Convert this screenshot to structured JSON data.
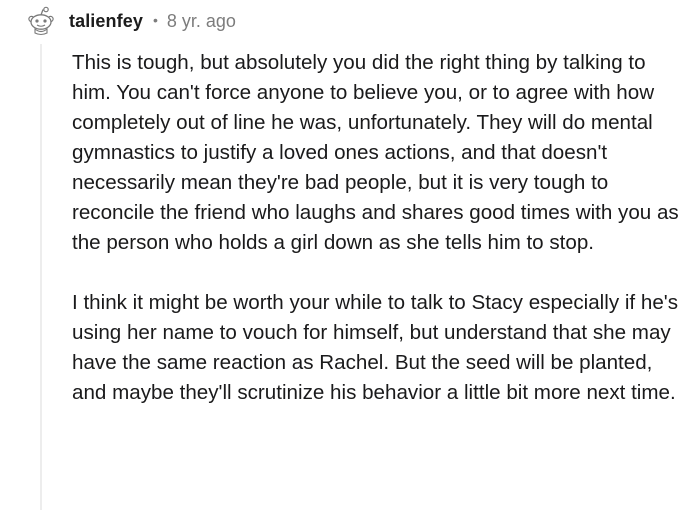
{
  "comment": {
    "author": "talienfey",
    "separator": "•",
    "age": "8 yr. ago",
    "avatar_icon": "snoo-avatar-icon",
    "paragraphs": [
      "This is tough, but absolutely you did the right thing by talking to him. You can't force anyone to believe you, or to agree with how completely out of line he was, unfortunately. They will do mental gymnastics to justify a loved ones actions, and that doesn't necessarily mean they're bad people, but it is very tough to reconcile the friend who laughs and shares good times with you as the person who holds a girl down as she tells him to stop.",
      "I think it might be worth your while to talk to Stacy especially if he's using her name to vouch for himself, but understand that she may have the same reaction as Rachel. But the seed will be planted, and maybe they'll scrutinize his behavior a little bit more next time."
    ]
  },
  "colors": {
    "text": "#1a1a1b",
    "meta": "#7c7c7c",
    "thread_line": "#ededed"
  }
}
